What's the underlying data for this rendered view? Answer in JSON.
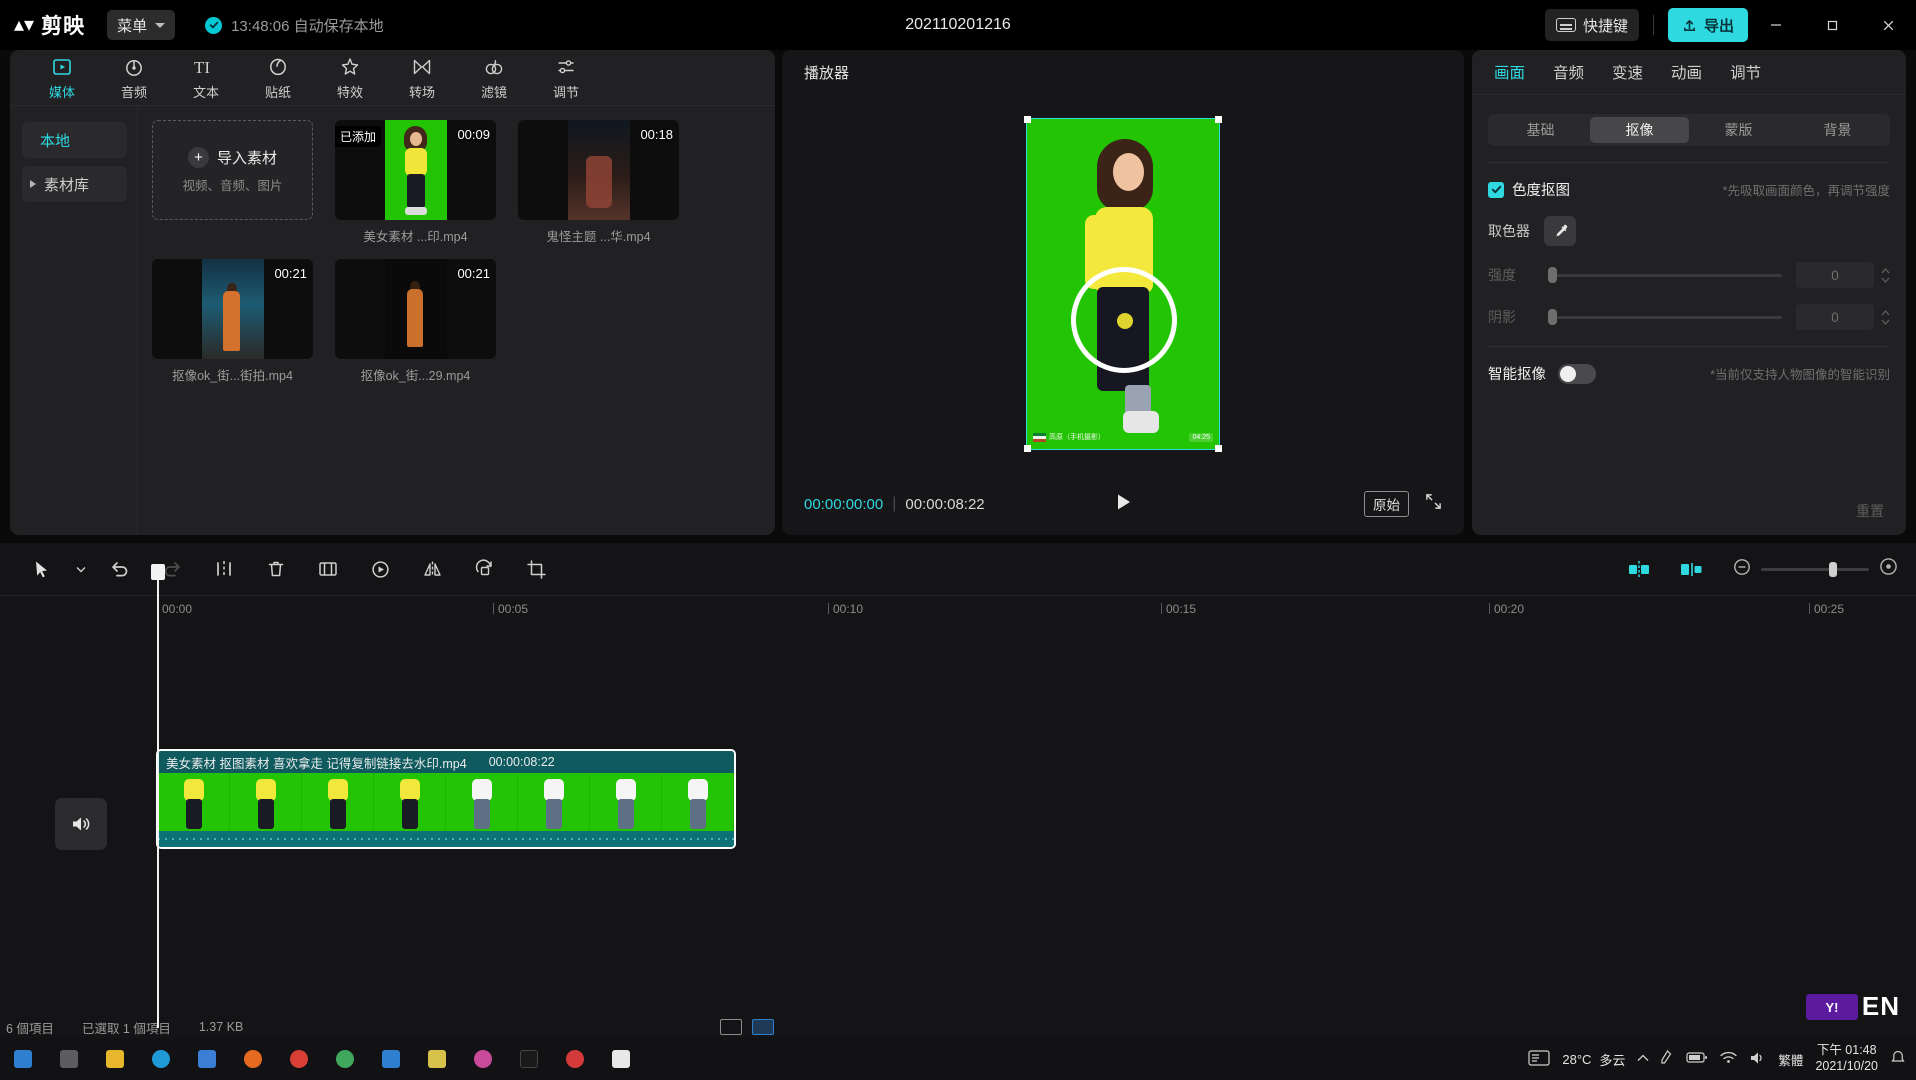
{
  "titlebar": {
    "app_name": "剪映",
    "menu_label": "菜单",
    "autosave_text": "13:48:06 自动保存本地",
    "project_title": "202110201216",
    "hotkey_label": "快捷键",
    "export_label": "导出",
    "minimize_icon": "minimize-icon",
    "maximize_icon": "maximize-icon",
    "close_icon": "close-icon",
    "accent": "#2fd9e0"
  },
  "left_panel": {
    "tabs": [
      {
        "label": "媒体",
        "icon": "media-icon",
        "active": true
      },
      {
        "label": "音频",
        "icon": "audio-icon",
        "active": false
      },
      {
        "label": "文本",
        "icon": "text-icon",
        "active": false
      },
      {
        "label": "贴纸",
        "icon": "sticker-icon",
        "active": false
      },
      {
        "label": "特效",
        "icon": "effects-icon",
        "active": false
      },
      {
        "label": "转场",
        "icon": "transition-icon",
        "active": false
      },
      {
        "label": "滤镜",
        "icon": "filter-icon",
        "active": false
      },
      {
        "label": "调节",
        "icon": "adjust-icon",
        "active": false
      }
    ],
    "nav": [
      {
        "label": "本地",
        "active": true,
        "expandable": false
      },
      {
        "label": "素材库",
        "active": false,
        "expandable": true
      }
    ],
    "import": {
      "title": "导入素材",
      "subtitle": "视频、音频、图片"
    },
    "items": [
      {
        "name": "美女素材 ...印.mp4",
        "duration": "00:09",
        "badge": "已添加",
        "thumb": "greenscreen"
      },
      {
        "name": "鬼怪主题 ...华.mp4",
        "duration": "00:18",
        "badge": "",
        "thumb": "night"
      },
      {
        "name": "抠像ok_街...街拍.mp4",
        "duration": "00:21",
        "badge": "",
        "thumb": "street"
      },
      {
        "name": "抠像ok_街...29.mp4",
        "duration": "00:21",
        "badge": "",
        "thumb": "solo"
      }
    ]
  },
  "player": {
    "header": "播放器",
    "current_time": "00:00:00:00",
    "total_time": "00:00:08:22",
    "play_icon": "play-icon",
    "ratio_label": "原始",
    "fullscreen_icon": "fullscreen-icon",
    "watermark_left": "高原（手机摄影）",
    "watermark_right": "04:25"
  },
  "properties": {
    "tabs": [
      {
        "label": "画面",
        "active": true
      },
      {
        "label": "音频",
        "active": false
      },
      {
        "label": "变速",
        "active": false
      },
      {
        "label": "动画",
        "active": false
      },
      {
        "label": "调节",
        "active": false
      }
    ],
    "segments": [
      {
        "label": "基础",
        "active": false
      },
      {
        "label": "抠像",
        "active": true
      },
      {
        "label": "蒙版",
        "active": false
      },
      {
        "label": "背景",
        "active": false
      }
    ],
    "chroma": {
      "label": "色度抠图",
      "checked": true,
      "hint": "*先吸取画面颜色，再调节强度"
    },
    "picker": {
      "label": "取色器",
      "icon": "eyedropper-icon"
    },
    "sliders": [
      {
        "label": "强度",
        "value": "0",
        "percent": 0,
        "disabled": true
      },
      {
        "label": "阴影",
        "value": "0",
        "percent": 0,
        "disabled": true
      }
    ],
    "smart_matting": {
      "label": "智能抠像",
      "enabled": false,
      "hint": "*当前仅支持人物图像的智能识别"
    },
    "reset_label": "重置"
  },
  "timeline": {
    "tools": [
      {
        "icon": "select-arrow-icon",
        "name": "select-tool",
        "dim": false
      },
      {
        "icon": "chevron-down-icon",
        "name": "select-dropdown",
        "dim": false
      },
      {
        "icon": "undo-icon",
        "name": "undo-button",
        "dim": false
      },
      {
        "icon": "redo-icon",
        "name": "redo-button",
        "dim": true
      },
      {
        "icon": "split-icon",
        "name": "split-button",
        "dim": false
      },
      {
        "icon": "delete-icon",
        "name": "delete-button",
        "dim": false
      },
      {
        "icon": "crop-frame-icon",
        "name": "crop-button",
        "dim": false
      },
      {
        "icon": "freeze-icon",
        "name": "freeze-button",
        "dim": false
      },
      {
        "icon": "mirror-icon",
        "name": "mirror-button",
        "dim": false
      },
      {
        "icon": "rotate-icon",
        "name": "rotate-button",
        "dim": false
      },
      {
        "icon": "crop-icon",
        "name": "crop-tool-button",
        "dim": false
      }
    ],
    "right_tools": [
      {
        "icon": "auto-snap-icon",
        "name": "auto-snap-button",
        "active": true
      },
      {
        "icon": "align-icon",
        "name": "align-button",
        "active": true
      },
      {
        "icon": "zoom-out-icon",
        "name": "zoom-out-button",
        "active": false
      },
      {
        "icon": "zoom-fit-icon",
        "name": "zoom-fit-button",
        "active": false
      }
    ],
    "ruler_ticks": [
      "00:00",
      "00:05",
      "00:10",
      "00:15",
      "00:20",
      "00:25"
    ],
    "mute_icon": "mute-speaker-icon",
    "clip": {
      "title": "美女素材 抠图素材 喜欢拿走 记得复制链接去水印.mp4",
      "duration": "00:00:08:22"
    }
  },
  "statusbar": {
    "item_count": "6 個項目",
    "selection": "已選取 1 個項目",
    "size": "1.37 KB",
    "view_list_icon": "list-view-icon",
    "view_grid_icon": "grid-view-icon"
  },
  "taskbar": {
    "temperature": "28°C",
    "weather": "多云",
    "ime": "繁體",
    "time": "下午 01:48",
    "date": "2021/10/20",
    "lang_badge": "EN",
    "yahoo_label": "Y!"
  }
}
